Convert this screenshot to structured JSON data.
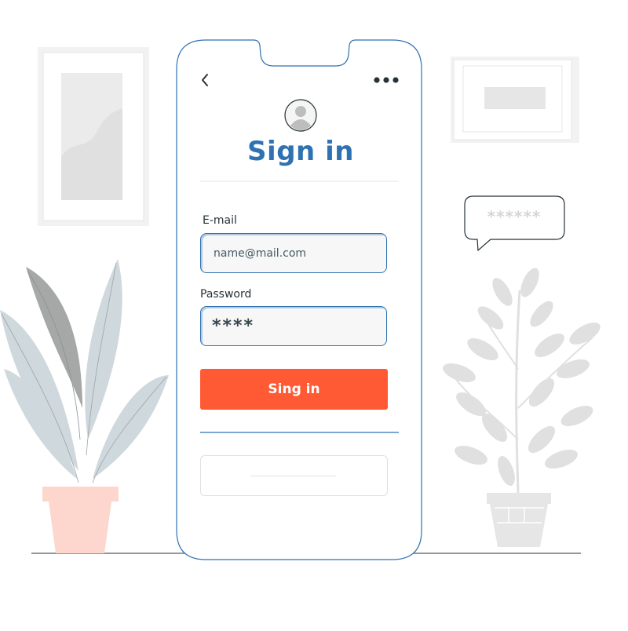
{
  "screen": {
    "title": "Sign in",
    "email_label": "E-mail",
    "email_value": "name@mail.com",
    "password_label": "Password",
    "password_value": "****",
    "button_label": "Sing in"
  },
  "bubble": {
    "text": "******"
  },
  "icons": {
    "back": "chevron-left-icon",
    "more": "more-horizontal-icon",
    "avatar": "user-avatar-icon"
  },
  "colors": {
    "accent_blue": "#2f72b2",
    "button_orange": "#ff5a33",
    "plant_leaf": "#cfd8dc",
    "plant_leaf_dark": "#a6a8a8",
    "pot_pink": "#fdd6ce",
    "decor_grey": "#e6e6e6"
  }
}
